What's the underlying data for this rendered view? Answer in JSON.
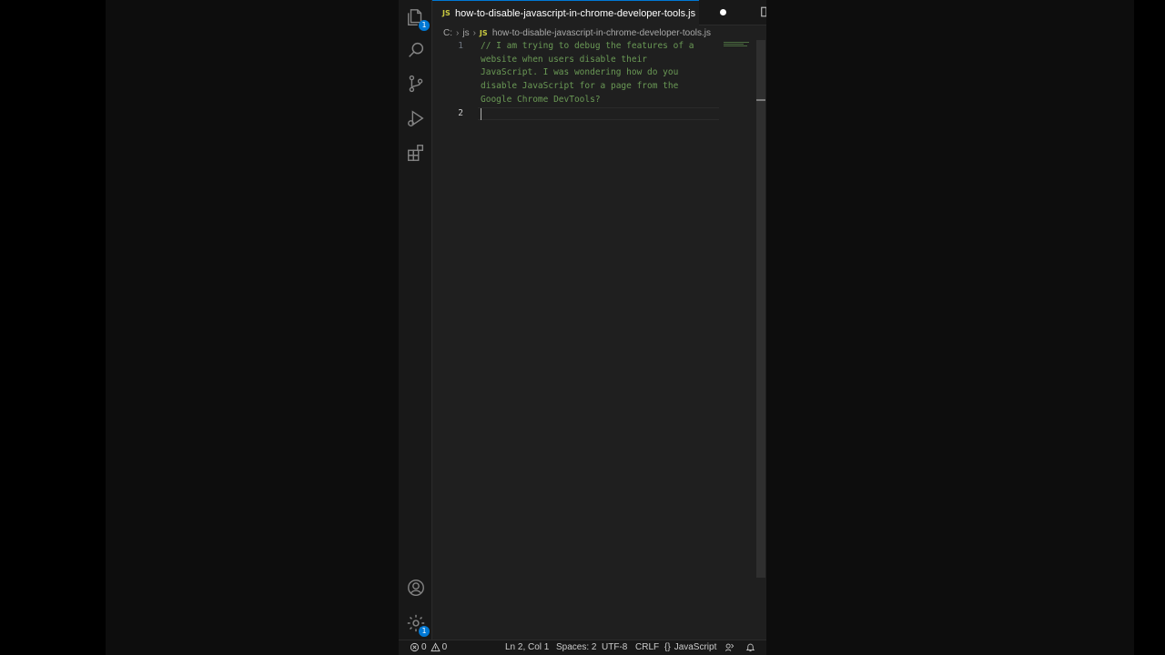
{
  "tab": {
    "js_badge": "JS",
    "filename": "how-to-disable-javascript-in-chrome-developer-tools.js"
  },
  "breadcrumb": {
    "drive": "C:",
    "folder": "js",
    "js_badge": "JS",
    "file": "how-to-disable-javascript-in-chrome-developer-tools.js"
  },
  "activity_bar": {
    "explorer_badge": "1",
    "settings_badge": "1"
  },
  "editor": {
    "lines": [
      {
        "number": "1",
        "text": "// I am trying to debug the features of a"
      },
      {
        "number": "",
        "text": "website when users disable their"
      },
      {
        "number": "",
        "text": "JavaScript. I was wondering how do you"
      },
      {
        "number": "",
        "text": "disable JavaScript for a page from the"
      },
      {
        "number": "",
        "text": "Google Chrome DevTools?"
      },
      {
        "number": "2",
        "text": ""
      }
    ]
  },
  "statusbar": {
    "errors": "0",
    "warnings": "0",
    "position": "Ln 2, Col 1",
    "spaces": "Spaces: 2",
    "encoding": "UTF-8",
    "eol": "CRLF",
    "language_glyph": "{}",
    "language": "JavaScript"
  },
  "colors": {
    "accent": "#0078d4",
    "comment": "#6a9955",
    "js_icon": "#cbcb41"
  }
}
